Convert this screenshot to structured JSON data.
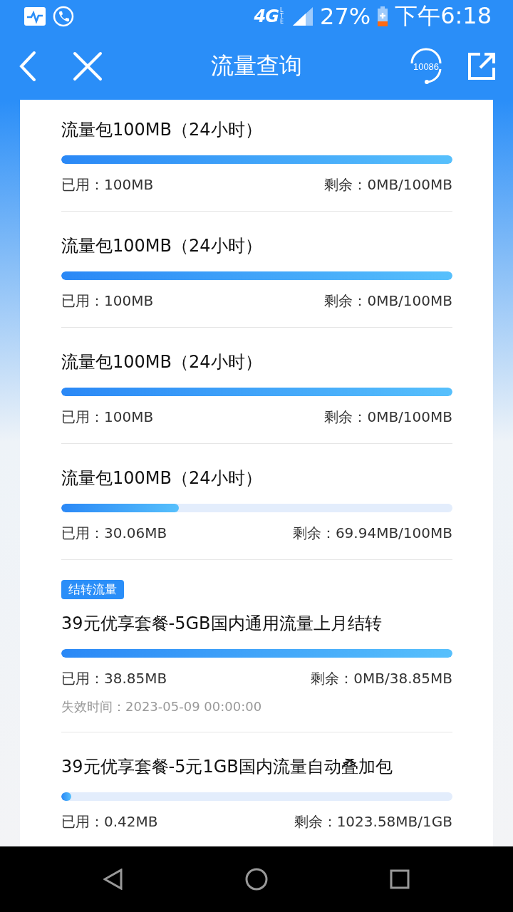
{
  "status_bar": {
    "network": "4G",
    "network_sub": "LTE",
    "battery": "27%",
    "time": "下午6:18"
  },
  "header": {
    "title": "流量查询",
    "service_number": "10086"
  },
  "packages": [
    {
      "title": "流量包100MB（24小时）",
      "level": 1,
      "used": "已用：100MB",
      "remaining": "剩余：0MB/100MB"
    },
    {
      "title": "流量包100MB（24小时）",
      "level": 1,
      "used": "已用：100MB",
      "remaining": "剩余：0MB/100MB"
    },
    {
      "title": "流量包100MB（24小时）",
      "level": 1,
      "used": "已用：100MB",
      "remaining": "剩余：0MB/100MB"
    },
    {
      "title": "流量包100MB（24小时）",
      "level": 0.3006,
      "used": "已用：30.06MB",
      "remaining": "剩余：69.94MB/100MB"
    },
    {
      "tag": "结转流量",
      "title": "39元优享套餐-5GB国内通用流量上月结转",
      "level": 1,
      "used": "已用：38.85MB",
      "remaining": "剩余：0MB/38.85MB",
      "expiry": "失效时间：2023-05-09 00:00:00"
    },
    {
      "title": "39元优享套餐-5元1GB国内流量自动叠加包",
      "level": 0.0004,
      "used": "已用：0.42MB",
      "remaining": "剩余：1023.58MB/1GB"
    }
  ]
}
